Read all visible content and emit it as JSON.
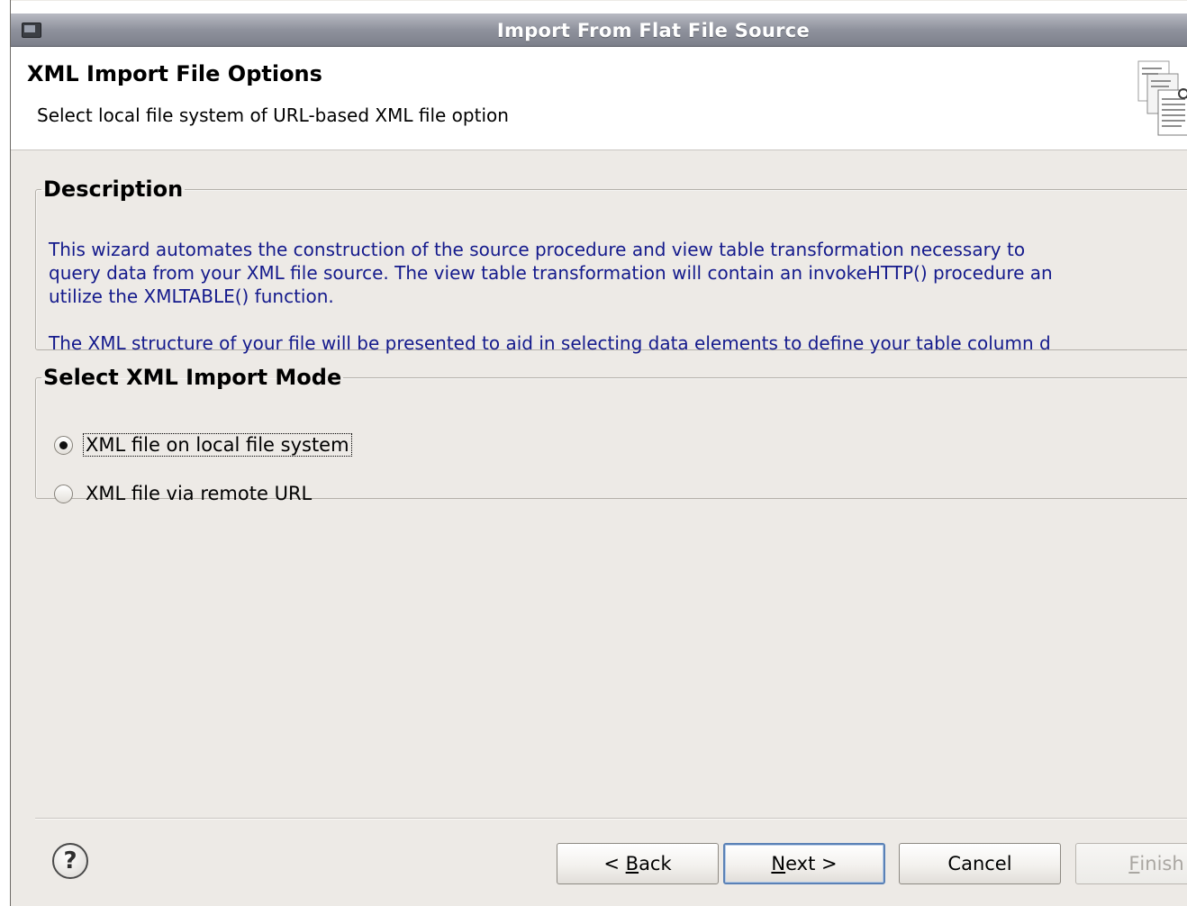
{
  "window": {
    "title": "Import From Flat File Source"
  },
  "header": {
    "title": "XML Import File Options",
    "subtitle": "Select local file system of URL-based XML file option",
    "icon": "documents-icon"
  },
  "description": {
    "legend": "Description",
    "lines": [
      "This wizard automates the construction of the source procedure and view table transformation necessary to",
      "query data from your XML file source. The view table transformation will contain an invokeHTTP() procedure an",
      "utilize the XMLTABLE() function.",
      "",
      "The XML structure of your file will be presented to aid in selecting data elements to define your table column d"
    ]
  },
  "import_mode": {
    "legend": "Select XML Import Mode",
    "options": [
      {
        "label": "XML file on local file system",
        "selected": true
      },
      {
        "label": "XML file via remote URL",
        "selected": false
      }
    ]
  },
  "footer": {
    "help_icon": "help-icon",
    "back": {
      "prefix": "< ",
      "mnemonic": "B",
      "rest": "ack"
    },
    "next": {
      "mnemonic": "N",
      "rest": "ext >"
    },
    "cancel": "Cancel",
    "finish": {
      "mnemonic": "F",
      "rest": "inish"
    }
  }
}
